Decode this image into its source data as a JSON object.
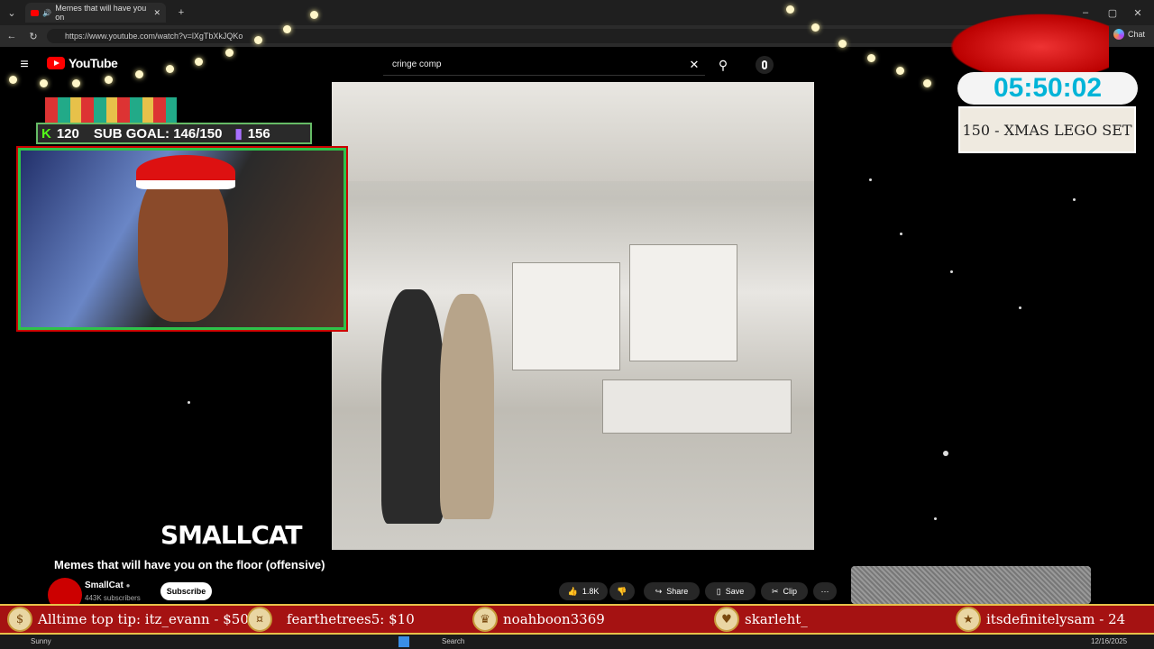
{
  "browser": {
    "tab_title": "Memes that will have you on",
    "url": "https://www.youtube.com/watch?v=lXgTbXkJQKo",
    "chat_label": "Chat"
  },
  "youtube": {
    "logo_text": "YouTube",
    "search_value": "cringe comp"
  },
  "overlay": {
    "kick_count": "120",
    "sub_goal": "SUB GOAL: 146/150",
    "twitch_count": "156",
    "streamer_logo": "SMALLCAT",
    "timer": "05:50:02",
    "goal_text": "150 - XMAS LEGO SET"
  },
  "video_info": {
    "title": "Memes that will have you on the floor (offensive)",
    "channel": "SmallCat",
    "subscribers": "443K subscribers",
    "subscribe_label": "Subscribe",
    "likes": "1.8K",
    "share_label": "Share",
    "save_label": "Save",
    "clip_label": "Clip"
  },
  "ticker": [
    {
      "text": "Alltime top tip: itz_evann - $500",
      "icon": "coin-icon"
    },
    {
      "text": "fearthetrees5: $10",
      "icon": "money-icon"
    },
    {
      "text": "noahboon3369",
      "icon": "trophy-icon"
    },
    {
      "text": "skarleht_",
      "icon": "heart-icon"
    },
    {
      "text": "itsdefinitelysam - 24",
      "icon": "star-icon"
    }
  ],
  "taskbar": {
    "weather": "Sunny",
    "search_label": "Search",
    "date": "12/16/2025"
  },
  "colors": {
    "youtube_red": "#ff0000",
    "ticker_red": "#a51212",
    "timer_cyan": "#00b4d8",
    "cam_border": "#2ec24a"
  }
}
